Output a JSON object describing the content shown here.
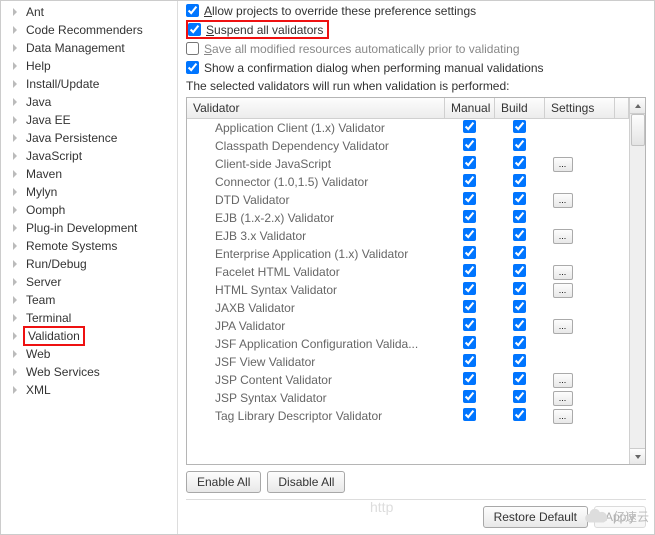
{
  "options": {
    "allow_override": "Allow projects to override these preference settings",
    "suspend": "Suspend all validators",
    "save_modified": "Save all modified resources automatically prior to validating",
    "show_confirmation": "Show a confirmation dialog when performing manual validations",
    "caption": "The selected validators will run when validation is performed:"
  },
  "tree": [
    "Ant",
    "Code Recommenders",
    "Data Management",
    "Help",
    "Install/Update",
    "Java",
    "Java EE",
    "Java Persistence",
    "JavaScript",
    "Maven",
    "Mylyn",
    "Oomph",
    "Plug-in Development",
    "Remote Systems",
    "Run/Debug",
    "Server",
    "Team",
    "Terminal",
    "Validation",
    "Web",
    "Web Services",
    "XML"
  ],
  "columns": {
    "validator": "Validator",
    "manual": "Manual",
    "build": "Build",
    "settings": "Settings"
  },
  "rows": [
    {
      "name": "Application Client (1.x) Validator",
      "m": true,
      "b": true,
      "s": false
    },
    {
      "name": "Classpath Dependency Validator",
      "m": true,
      "b": true,
      "s": false
    },
    {
      "name": "Client-side JavaScript",
      "m": true,
      "b": true,
      "s": true
    },
    {
      "name": "Connector (1.0,1.5) Validator",
      "m": true,
      "b": true,
      "s": false
    },
    {
      "name": "DTD Validator",
      "m": true,
      "b": true,
      "s": true
    },
    {
      "name": "EJB (1.x-2.x) Validator",
      "m": true,
      "b": true,
      "s": false
    },
    {
      "name": "EJB 3.x Validator",
      "m": true,
      "b": true,
      "s": true
    },
    {
      "name": "Enterprise Application (1.x) Validator",
      "m": true,
      "b": true,
      "s": false
    },
    {
      "name": "Facelet HTML Validator",
      "m": true,
      "b": true,
      "s": true
    },
    {
      "name": "HTML Syntax Validator",
      "m": true,
      "b": true,
      "s": true
    },
    {
      "name": "JAXB Validator",
      "m": true,
      "b": true,
      "s": false
    },
    {
      "name": "JPA Validator",
      "m": true,
      "b": true,
      "s": true
    },
    {
      "name": "JSF Application Configuration Valida...",
      "m": true,
      "b": true,
      "s": false
    },
    {
      "name": "JSF View Validator",
      "m": true,
      "b": true,
      "s": false
    },
    {
      "name": "JSP Content Validator",
      "m": true,
      "b": true,
      "s": true
    },
    {
      "name": "JSP Syntax Validator",
      "m": true,
      "b": true,
      "s": true
    },
    {
      "name": "Tag Library Descriptor Validator",
      "m": true,
      "b": true,
      "s": true
    }
  ],
  "buttons": {
    "enable": "Enable All",
    "disable": "Disable All",
    "restore": "Restore Default",
    "apply": "Apply"
  },
  "watermark": "亿速云",
  "ghost": "http"
}
